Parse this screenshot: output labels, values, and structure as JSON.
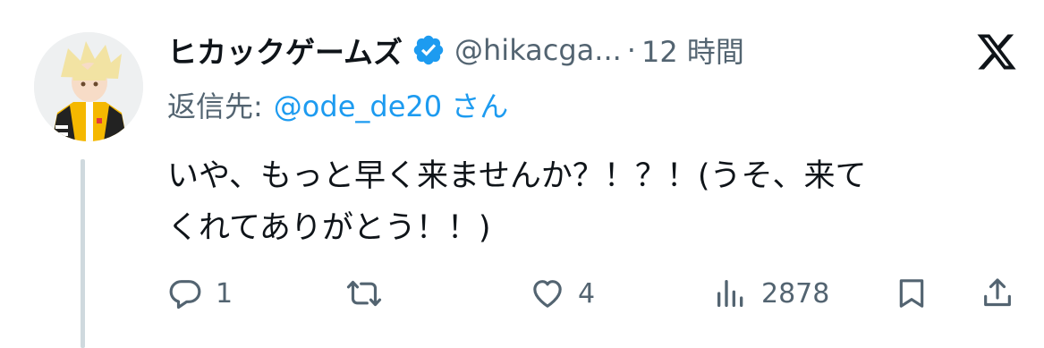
{
  "tweet": {
    "display_name": "ヒカックゲームズ",
    "handle": "@hikacga...",
    "separator": "·",
    "time": "12 時間",
    "reply_prefix": "返信先:",
    "reply_mention": "@ode_de20 さん",
    "text_line1": "いや、もっと早く来ませんか？！？！(うそ、来て",
    "text_line2": "くれてありがとう！！)"
  },
  "actions": {
    "replies": "1",
    "retweets": "",
    "likes": "4",
    "views": "2878"
  },
  "colors": {
    "verified": "#1d9bf0",
    "mention": "#1d9bf0",
    "muted": "#536471",
    "text": "#0f1419",
    "thread_line": "#cfd9de"
  },
  "icons": [
    "verified-badge-icon",
    "x-logo-icon",
    "reply-icon",
    "retweet-icon",
    "like-icon",
    "views-icon",
    "bookmark-icon",
    "share-icon"
  ]
}
